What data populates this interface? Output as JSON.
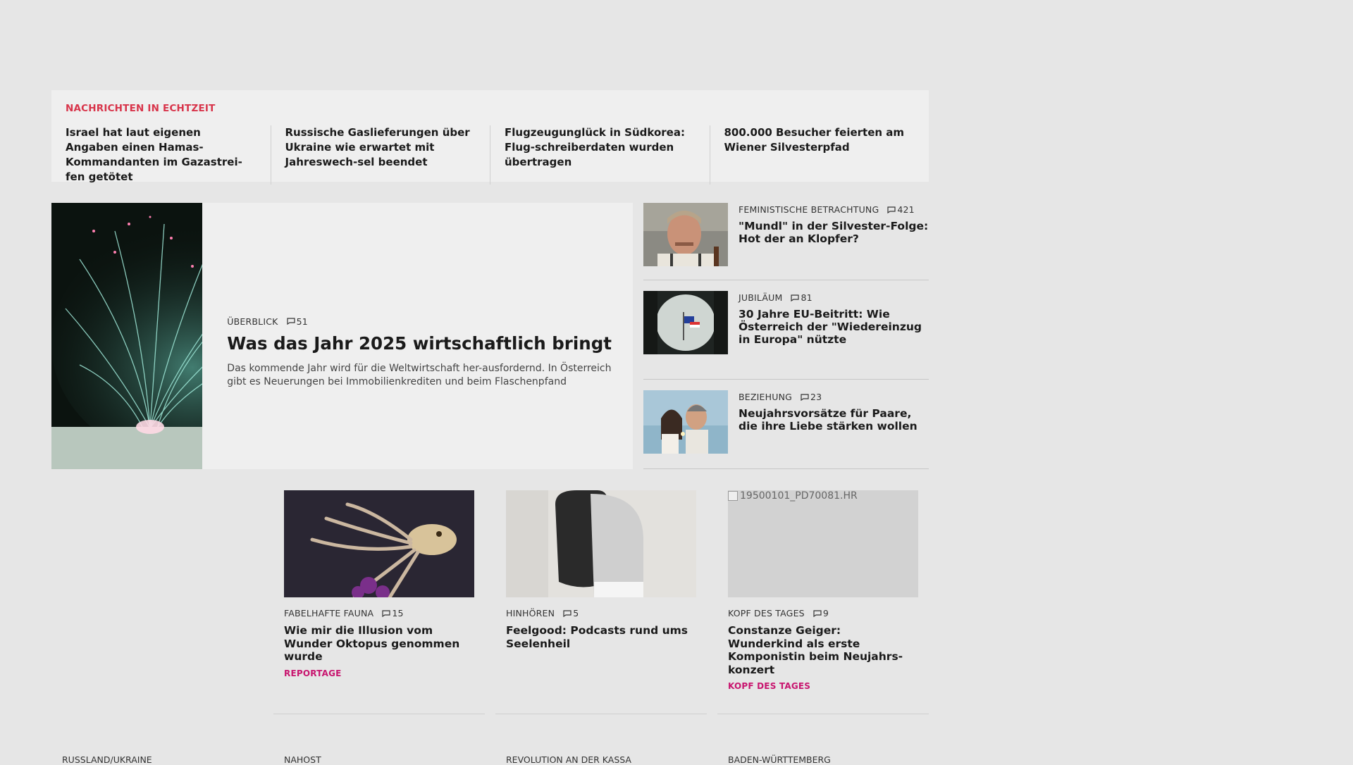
{
  "ticker": {
    "title": "NACHRICHTEN IN ECHTZEIT",
    "items": [
      "Israel hat laut eigenen Angaben einen Hamas-Kommandanten im Gazastrei-fen getötet",
      "Russische Gaslieferungen über Ukraine wie erwartet mit Jahreswech-sel beendet",
      "Flugzeugunglück in Südkorea: Flug-schreiberdaten wurden übertragen",
      "800.000 Besucher feierten am Wiener Silvesterpfad"
    ]
  },
  "hero": {
    "kicker": "ÜBERBLICK",
    "comments": "51",
    "title": "Was das Jahr 2025 wirtschaftlich bringt",
    "description": "Das kommende Jahr wird für die Weltwirtschaft her-ausfordernd. In Österreich gibt es Neuerungen bei Immobilienkrediten und beim Flaschenpfand"
  },
  "side": [
    {
      "kicker": "FEMINISTISCHE BETRACHTUNG",
      "comments": "421",
      "title": "\"Mundl\" in der Silvester-Folge: Hot der an Klopfer?"
    },
    {
      "kicker": "JUBILÄUM",
      "comments": "81",
      "title": "30 Jahre EU-Beitritt: Wie Österreich der \"Wiedereinzug in Europa\" nützte"
    },
    {
      "kicker": "BEZIEHUNG",
      "comments": "23",
      "title": "Neujahrsvorsätze für Paare, die ihre Liebe stärken wollen"
    }
  ],
  "cards": [
    {
      "kicker": "FABELHAFTE FAUNA",
      "comments": "15",
      "title": "Wie mir die Illusion vom Wunder Oktopus genommen wurde",
      "tag": "REPORTAGE"
    },
    {
      "kicker": "HINHÖREN",
      "comments": "5",
      "title": "Feelgood: Podcasts rund ums Seelenheil",
      "tag": ""
    },
    {
      "kicker": "KOPF DES TAGES",
      "comments": "9",
      "title": "Constanze Geiger: Wunderkind als erste Komponistin beim Neujahrs-konzert",
      "tag": "KOPF DES TAGES",
      "image_alt": "19500101_PD70081.HR"
    }
  ],
  "bottom_kickers": [
    "RUSSLAND/UKRAINE",
    "NAHOST",
    "REVOLUTION AN DER KASSA",
    "BADEN-WÜRTTEMBERG"
  ],
  "colors": {
    "ticker_accent": "#d8344a",
    "tag_accent": "#c8156f",
    "background": "#e6e6e6"
  }
}
